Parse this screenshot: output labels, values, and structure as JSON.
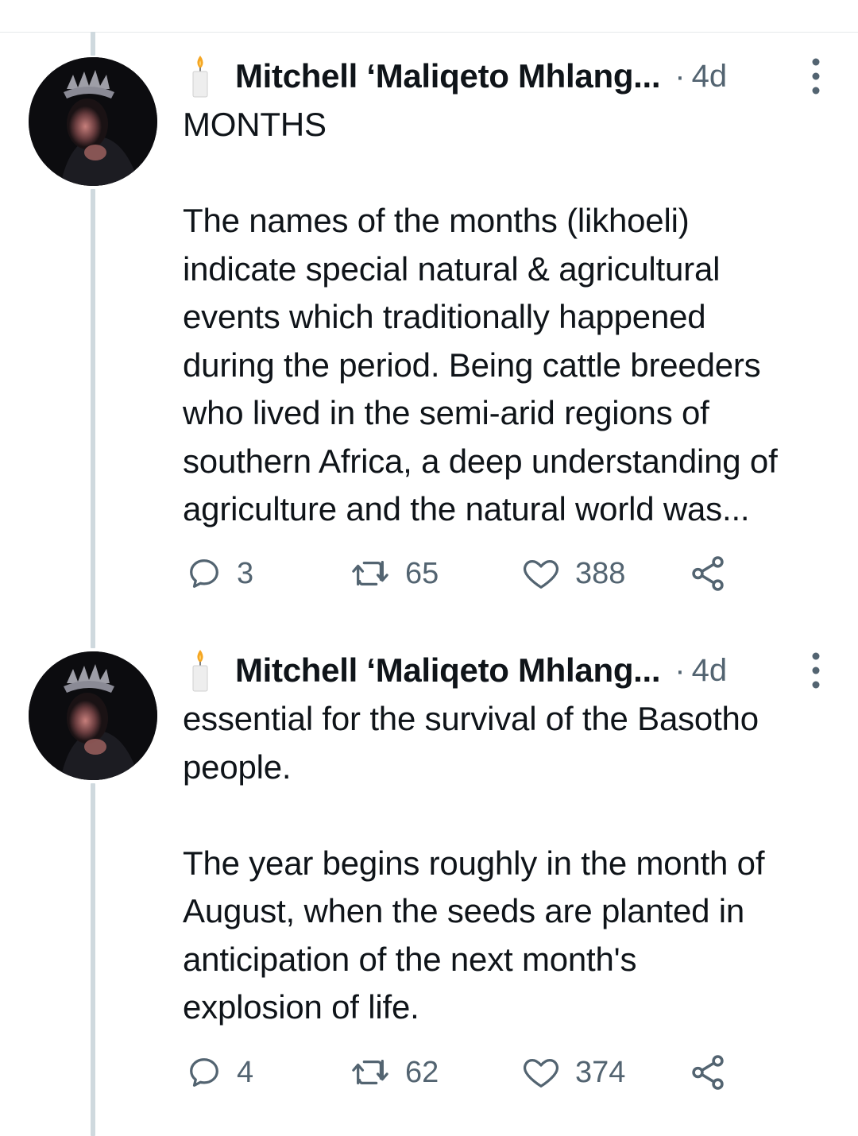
{
  "tweets": [
    {
      "author": "Mitchell ‘Maliqeto Mhlang...",
      "separator": "·",
      "time": "4d",
      "text": "MONTHS\n\nThe names of the months (likhoeli)\nindicate special natural & agricultural\nevents which traditionally happened\nduring the period. Being cattle breeders\nwho lived in the semi-arid regions of\nsouthern Africa, a deep understanding of\nagriculture and the natural world was...",
      "replies": "3",
      "retweets": "65",
      "likes": "388"
    },
    {
      "author": "Mitchell ‘Maliqeto Mhlang...",
      "separator": "·",
      "time": "4d",
      "text": "essential for the survival of the Basotho\npeople.\n\nThe year begins roughly in the month of\nAugust, when the seeds are planted in\nanticipation of the next month's\nexplosion of life.",
      "replies": "4",
      "retweets": "62",
      "likes": "374"
    }
  ],
  "icons": {
    "author_emoji": "candle-icon",
    "reply": "reply-icon",
    "retweet": "retweet-icon",
    "like": "heart-icon",
    "share": "share-icon",
    "more": "more-icon"
  },
  "colors": {
    "secondary_text": "#536471",
    "thread_line": "#cfd9de"
  }
}
